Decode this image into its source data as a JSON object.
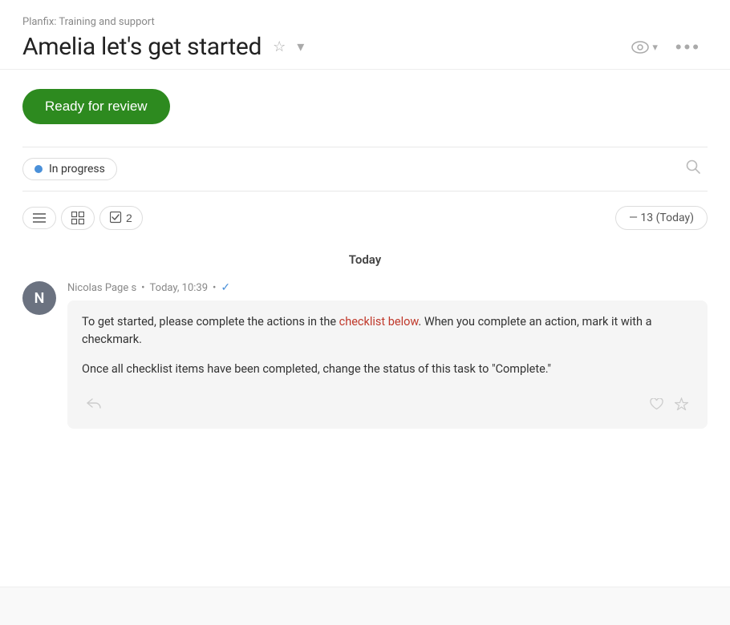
{
  "breadcrumb": {
    "text": "Planfix: Training and support"
  },
  "header": {
    "title": "Amelia let's get started",
    "star_icon": "☆",
    "chevron_icon": "▾",
    "eye_icon": "👁",
    "eye_chevron": "▾",
    "more_icon": "•••"
  },
  "status_button": {
    "label": "Ready for review"
  },
  "progress_badge": {
    "label": "In progress"
  },
  "search_placeholder": "Search...",
  "toolbar": {
    "list_icon": "≡",
    "table_icon": "⊞",
    "checklist_label": "2"
  },
  "date_badge": {
    "label": "— 13 (Today)"
  },
  "today_label": "Today",
  "message": {
    "author": "Nicolas Page s",
    "time": "Today, 10:39",
    "avatar_letter": "N",
    "paragraph1_normal": "To get started, please complete the actions in the checklist below. When you complete an action, mark it with a checkmark.",
    "paragraph1_highlight_start": "To get started, please complete the actions in the ",
    "paragraph1_highlight": "checklist below",
    "paragraph1_end": ". When you complete an action, mark it with a checkmark.",
    "paragraph2": "Once all checklist items have been completed, change the status of this task to \"Complete.\""
  }
}
